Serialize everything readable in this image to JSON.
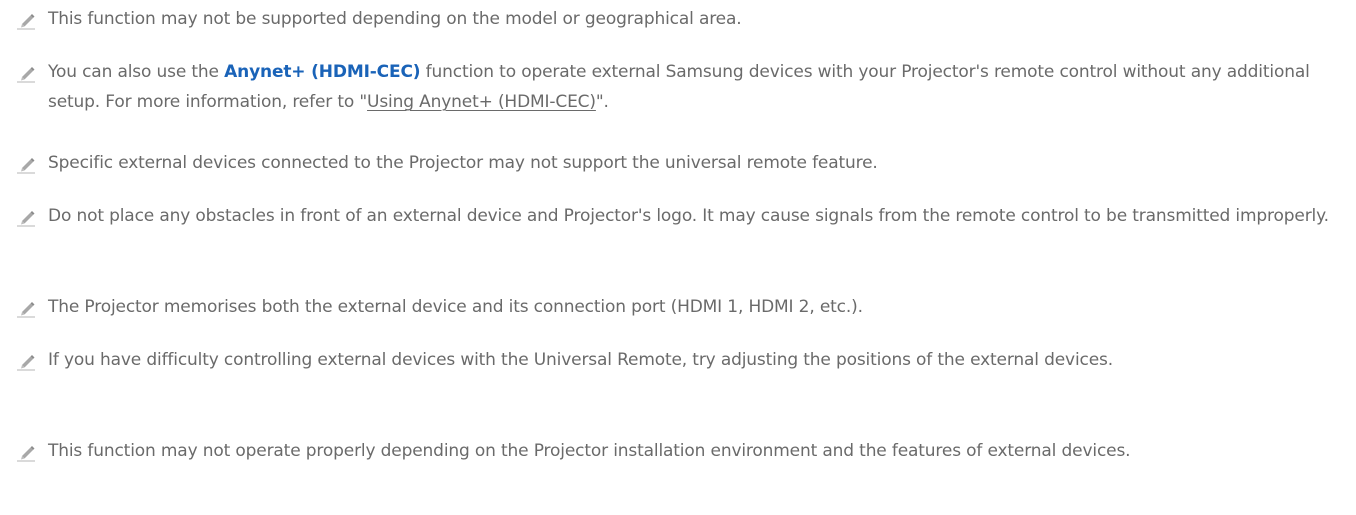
{
  "notes": [
    {
      "text": "This function may not be supported depending on the model or geographical area."
    },
    {
      "part1": "You can also use the ",
      "highlight": "Anynet+ (HDMI-CEC)",
      "part2": " function to operate external Samsung devices with your Projector's remote control without any additional setup. For more information, refer to \"",
      "link": "Using Anynet+ (HDMI-CEC)",
      "part3": "\"."
    },
    {
      "text": "Specific external devices connected to the Projector may not support the universal remote feature."
    },
    {
      "text": "Do not place any obstacles in front of an external device and Projector's logo. It may cause signals from the remote control to be transmitted improperly."
    },
    {
      "text": "The Projector memorises both the external device and its connection port (HDMI 1, HDMI 2, etc.)."
    },
    {
      "text": "If you have difficulty controlling external devices with the Universal Remote, try adjusting the positions of the external devices."
    },
    {
      "text": "This function may not operate properly depending on the Projector installation environment and the features of external devices."
    }
  ],
  "icon": "pencil-icon",
  "colors": {
    "text": "#6a6a6a",
    "highlight": "#1a63b8",
    "icon": "#9a9a9a"
  }
}
